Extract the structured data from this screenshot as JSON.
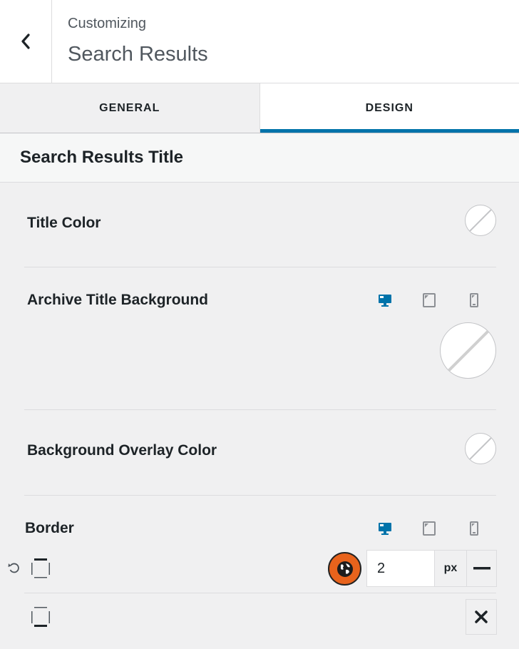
{
  "header": {
    "subtitle": "Customizing",
    "title": "Search Results",
    "back_icon": "chevron-left-icon"
  },
  "tabs": [
    {
      "label": "GENERAL",
      "active": false
    },
    {
      "label": "DESIGN",
      "active": true
    }
  ],
  "section": {
    "title": "Search Results Title"
  },
  "controls": {
    "title_color": {
      "label": "Title Color"
    },
    "archive_bg": {
      "label": "Archive Title Background",
      "device_icons": [
        "desktop-icon",
        "tablet-icon",
        "mobile-icon"
      ],
      "active_device": "desktop"
    },
    "overlay_color": {
      "label": "Background Overlay Color"
    },
    "border": {
      "label": "Border",
      "device_icons": [
        "desktop-icon",
        "tablet-icon",
        "mobile-icon"
      ],
      "active_device": "desktop",
      "top": {
        "value": "2",
        "unit": "px"
      }
    }
  },
  "colors": {
    "accent": "#0073aa",
    "globe_button": "#e8631c",
    "inactive_device": "#8c8f94"
  }
}
